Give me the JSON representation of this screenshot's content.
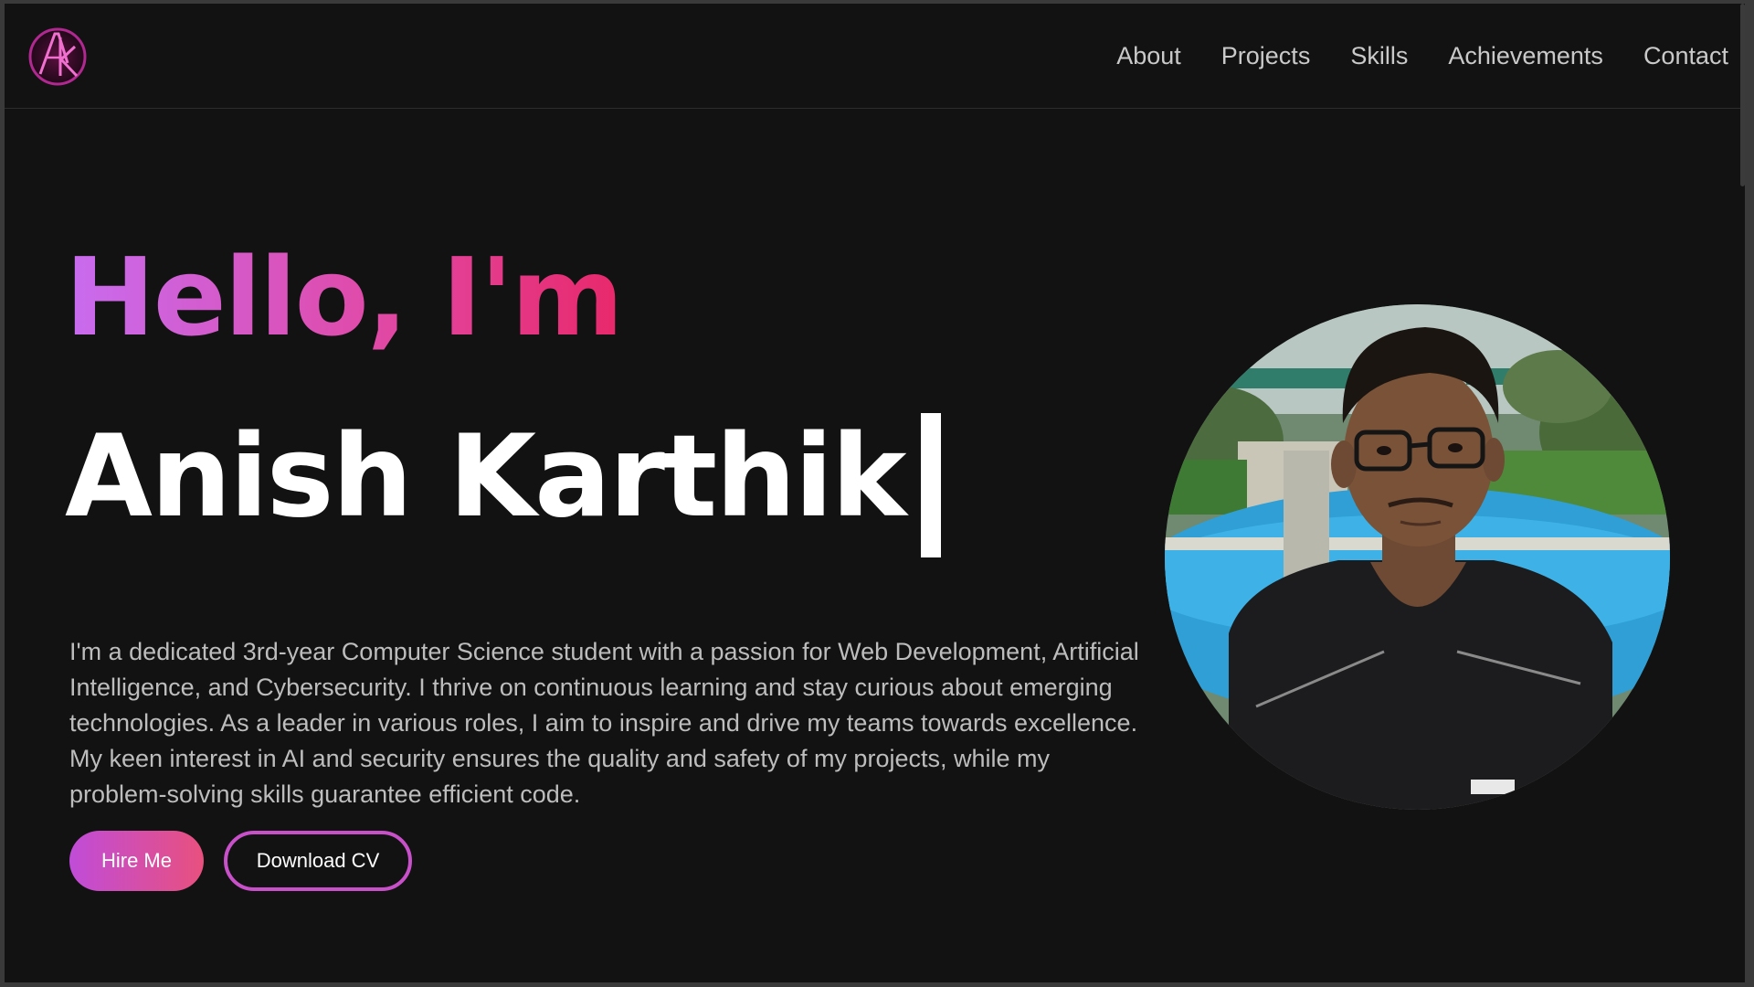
{
  "logo": {
    "text": "AK",
    "icon": "ak-monogram-logo"
  },
  "nav": {
    "items": [
      {
        "label": "About"
      },
      {
        "label": "Projects"
      },
      {
        "label": "Skills"
      },
      {
        "label": "Achievements"
      },
      {
        "label": "Contact"
      }
    ]
  },
  "hero": {
    "greeting": "Hello, I'm",
    "name": "Anish Karthik",
    "bio": "I'm a dedicated 3rd-year Computer Science student with a passion for Web Development, Artificial Intelligence, and Cybersecurity. I thrive on continuous learning and stay curious about emerging technologies. As a leader in various roles, I aim to inspire and drive my teams towards excellence. My keen interest in AI and security ensures the quality and safety of my projects, while my problem-solving skills guarantee efficient code.",
    "buttons": {
      "hire": "Hire Me",
      "download": "Download CV"
    }
  },
  "colors": {
    "background": "#121212",
    "gradient_start": "#c86cf0",
    "gradient_end": "#e8286a",
    "accent": "#c850c8",
    "text_muted": "#bdbdbd"
  }
}
